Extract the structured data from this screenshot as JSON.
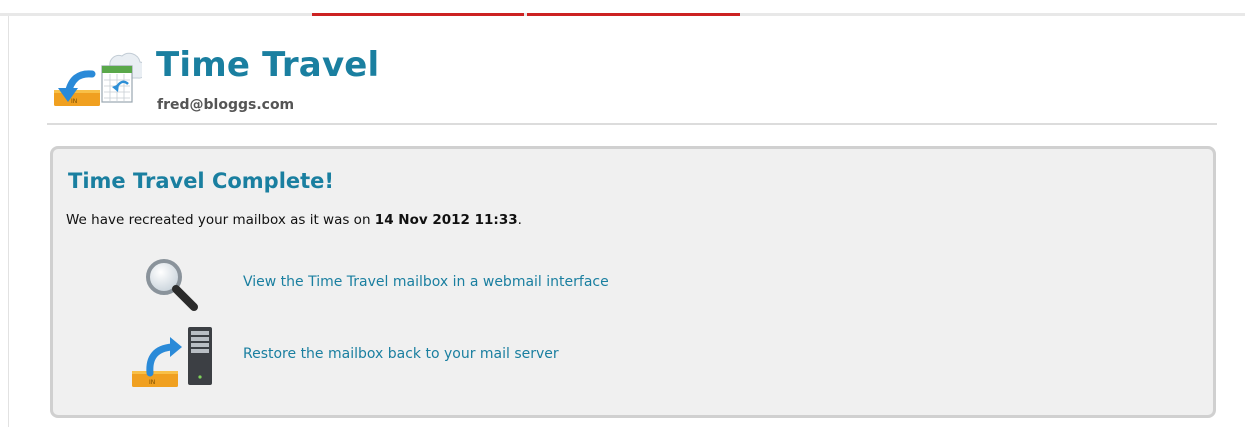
{
  "app": {
    "title": "Time Travel",
    "user_email": "fred@bloggs.com"
  },
  "result": {
    "heading": "Time Travel Complete!",
    "message_prefix": "We have recreated your mailbox as it was on",
    "timestamp": "14 Nov 2012 11:33",
    "message_suffix": "."
  },
  "actions": [
    {
      "label": "View the Time Travel mailbox in a webmail interface",
      "icon": "magnifying-glass-icon"
    },
    {
      "label": "Restore the mailbox back to your mail server",
      "icon": "restore-to-server-icon"
    }
  ],
  "colors": {
    "accent": "#1a7fa0",
    "progress_bar": "#cc2222",
    "panel_bg": "#f0f0f0",
    "panel_border": "#d0d0d0"
  }
}
